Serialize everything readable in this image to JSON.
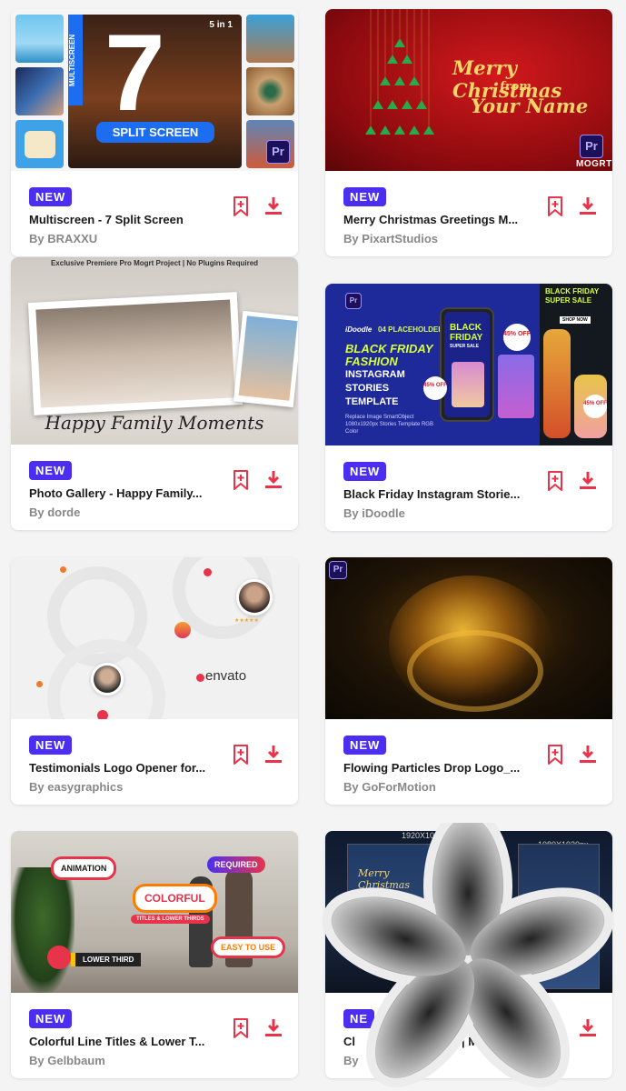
{
  "cards": [
    {
      "badge": "NEW",
      "title": "Multiscreen - 7 Split Screen",
      "author": "By BRAXXU",
      "art": {
        "big_number": "7",
        "label": "SPLIT SCREEN",
        "tag": "5 in 1",
        "side_text": "MULTISCREEN",
        "pr": "Pr"
      }
    },
    {
      "badge": "NEW",
      "title": "Merry Christmas Greetings M...",
      "author": "By PixartStudios",
      "art": {
        "line1": "Merry Christmas",
        "line2": "from",
        "line3": "Your Name",
        "pr": "Pr",
        "mogrt": "MOGRT"
      }
    },
    {
      "badge": "NEW",
      "title": "Photo Gallery - Happy Family...",
      "author": "By dorde",
      "art": {
        "header": "Exclusive Premiere Pro Mogrt Project | No Plugins Required",
        "script": "Happy Family Moments"
      }
    },
    {
      "badge": "NEW",
      "title": "Black Friday Instagram Storie...",
      "author": "By iDoodle",
      "art": {
        "pr": "Pr",
        "brand": "iDoodle",
        "placeholder": "04 PLACEHOLDER",
        "headline1": "BLACK FRIDAY",
        "headline2": "FASHION",
        "sub1": "INSTAGRAM",
        "sub2": "STORIES",
        "sub3": "TEMPLATE",
        "small": "Replace Image SmartObject 1080x1920px Stories Template RGB Color",
        "phone1": "BLACK",
        "phone2": "FRIDAY",
        "phone3": "SUPER SALE",
        "shop": "SHOP NOW",
        "off": "45% OFF",
        "sale": "BLACK FRIDAY SUPER SALE"
      }
    },
    {
      "badge": "NEW",
      "title": "Testimonials Logo Opener for...",
      "author": "By easygraphics",
      "art": {
        "logo": "envato",
        "stars": "★★★★★"
      }
    },
    {
      "badge": "NEW",
      "title": "Flowing Particles Drop Logo_...",
      "author": "By GoForMotion",
      "art": {
        "pr": "Pr"
      }
    },
    {
      "badge": "NEW",
      "title": "Colorful Line Titles & Lower T...",
      "author": "By Gelbbaum",
      "art": {
        "t1": "ANIMATION",
        "t2": "COLORFUL",
        "t3": "TITLES & LOWER THIRDS",
        "t4": "REQUIRED",
        "t5": "EASY TO USE",
        "t6": "LOWER THIRD"
      }
    },
    {
      "badge": "NE",
      "title": "Cl",
      "title_end": "| M",
      "author": "By",
      "art": {
        "dim1": "1920X1080",
        "dim2": "1080X1920px",
        "script": "Merry Christmas"
      }
    }
  ],
  "colors": {
    "badge": "#4b2ef0",
    "action": "#e8344a",
    "bg": "#f4f4f5"
  }
}
